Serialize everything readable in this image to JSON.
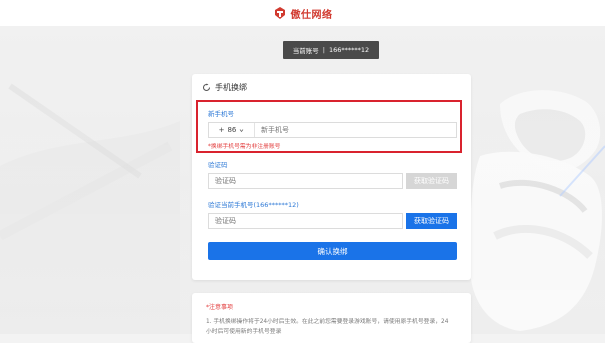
{
  "brand": {
    "name": "傲仕网络"
  },
  "account": {
    "label": "当前账号",
    "separator": "|",
    "value": "166******12"
  },
  "card": {
    "title": "手机换绑",
    "new_phone": {
      "label": "新手机号",
      "country_code_plus": "+",
      "country_code": "86",
      "placeholder": "新手机号",
      "error": "*换绑手机号需为非注册账号"
    },
    "verify_code": {
      "label": "验证码",
      "placeholder": "验证码",
      "button": "获取验证码"
    },
    "current_phone_code": {
      "label": "验证当前手机号(166******12)",
      "placeholder": "验证码",
      "button": "获取验证码"
    },
    "confirm_button": "确认换绑"
  },
  "notes": {
    "title": "*注意事项",
    "line1": "1. 手机换绑操作将于24小时后生效。在此之前您需要登录游戏账号，请使用原手机号登录，24",
    "line2": "小时后可使用新的手机号登录"
  },
  "colors": {
    "accent": "#1a73e8",
    "error": "#e23b3b",
    "highlight_border": "#d9232e",
    "disabled_button": "#d6d6d6",
    "badge_bg": "#4a4a4a",
    "brand": "#d13a2f"
  },
  "icons": {
    "logo": "brand-logo-icon",
    "refresh": "refresh-icon",
    "dropdown": "chevron-down-icon"
  }
}
